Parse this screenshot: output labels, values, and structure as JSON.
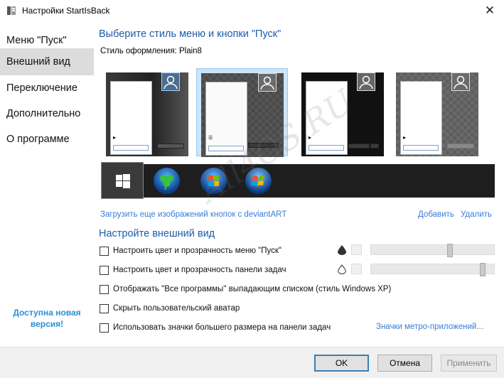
{
  "window": {
    "title": "Настройки StartIsBack",
    "close_glyph": "✕"
  },
  "sidebar": {
    "items": [
      {
        "label": "Меню \"Пуск\""
      },
      {
        "label": "Внешний вид"
      },
      {
        "label": "Переключение"
      },
      {
        "label": "Дополнительно"
      },
      {
        "label": "О программе"
      }
    ],
    "update_note": "Доступна новая версия!"
  },
  "main": {
    "heading": "Выберите стиль меню и кнопки \"Пуск\"",
    "style_label": "Стиль оформления:",
    "style_value": "Plain8",
    "more_buttons_link": "Загрузить еще изображений кнопок с deviantART",
    "add_link": "Добавить",
    "remove_link": "Удалить",
    "appearance_heading": "Настройте внешний вид",
    "options": [
      {
        "label": "Настроить цвет и прозрачность меню \"Пуск\"",
        "checked": false
      },
      {
        "label": "Настроить цвет и прозрачность панели задач",
        "checked": false
      },
      {
        "label": "Отображать \"Все программы\" выпадающим списком (стиль Windows XP)",
        "checked": false
      },
      {
        "label": "Скрыть пользовательский аватар",
        "checked": false
      },
      {
        "label": "Использовать значки большего размера на панели задач",
        "checked": false
      }
    ],
    "metro_link": "Значки метро-приложений...",
    "sliders": [
      {
        "icon": "drop-filled-icon",
        "level": 0.65
      },
      {
        "icon": "drop-outline-icon",
        "level": 0.93
      }
    ],
    "orbs": [
      "windows8-icon",
      "clover-icon",
      "windows7-orb-icon",
      "windows7-orb-icon"
    ]
  },
  "footer": {
    "ok": "OK",
    "cancel": "Отмена",
    "apply": "Применить"
  },
  "colors": {
    "accent": "#1c5aa8",
    "link": "#3a7bd5",
    "note": "#2a8fd4",
    "selection": "#cce4f7"
  },
  "watermark": "All4OS.RU"
}
